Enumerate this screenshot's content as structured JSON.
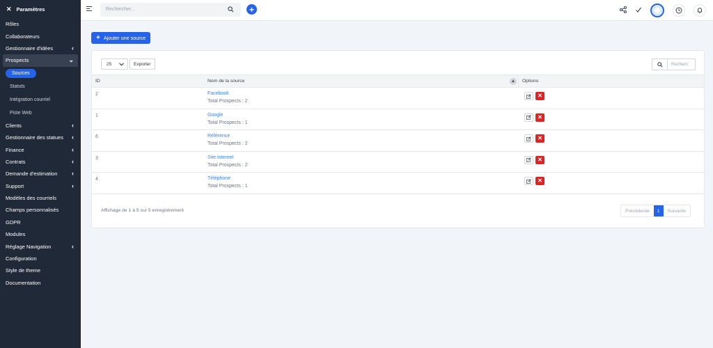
{
  "sidebar": {
    "title": "Paramètres",
    "items": [
      {
        "label": "Rôles",
        "chevron": ""
      },
      {
        "label": "Collaborateurs",
        "chevron": ""
      },
      {
        "label": "Gestionnaire d'idées",
        "chevron": "‹"
      },
      {
        "label": "Prospects",
        "chevron": "⌄"
      }
    ],
    "subitems": {
      "active": "Sources",
      "others": [
        "Statuts",
        "Intégration courriel",
        "Piste Web"
      ]
    },
    "items_after": [
      {
        "label": "Clients",
        "chevron": "‹"
      },
      {
        "label": "Gestionnaire des statues",
        "chevron": "‹"
      },
      {
        "label": "Finance",
        "chevron": "‹"
      },
      {
        "label": "Contrats",
        "chevron": "‹"
      },
      {
        "label": "Demande d'estimation",
        "chevron": "‹"
      },
      {
        "label": "Support",
        "chevron": "‹"
      },
      {
        "label": "Modèles des courriels",
        "chevron": ""
      },
      {
        "label": "Champs personnalisés",
        "chevron": ""
      },
      {
        "label": "GDPR",
        "chevron": ""
      },
      {
        "label": "Modules",
        "chevron": ""
      },
      {
        "label": "Réglage Navigation",
        "chevron": "‹"
      },
      {
        "label": "Configuration",
        "chevron": ""
      },
      {
        "label": "Style de theme",
        "chevron": ""
      },
      {
        "label": "Documentation",
        "chevron": ""
      }
    ]
  },
  "topbar": {
    "search_placeholder": "Rechercher...",
    "icons": [
      "share-icon",
      "check-icon",
      "avatar",
      "clock-icon",
      "bell-icon"
    ]
  },
  "main": {
    "add_button": "Ajouter une source",
    "page_length": "25",
    "export_label": "Exporter",
    "table_search_placeholder": "Recherc",
    "columns": {
      "id": "ID",
      "name": "Nom de la source",
      "options": "Options"
    },
    "rows": [
      {
        "id": "2",
        "name": "Facebook",
        "total": "Total Prospects : 2"
      },
      {
        "id": "1",
        "name": "Google",
        "total": "Total Prospects : 1"
      },
      {
        "id": "6",
        "name": "Référence",
        "total": "Total Prospects : 2"
      },
      {
        "id": "3",
        "name": "Site internet",
        "total": "Total Prospects : 2"
      },
      {
        "id": "4",
        "name": "Téléphone",
        "total": "Total Prospects : 1"
      }
    ],
    "info": "Affichage de 1 à 5 sur 5 enregistrement",
    "pagination": {
      "prev": "Précédente",
      "current": "1",
      "next": "Suivante"
    }
  },
  "colors": {
    "sidebar_bg": "#1f2937",
    "accent": "#2563eb",
    "danger": "#dc2626"
  }
}
